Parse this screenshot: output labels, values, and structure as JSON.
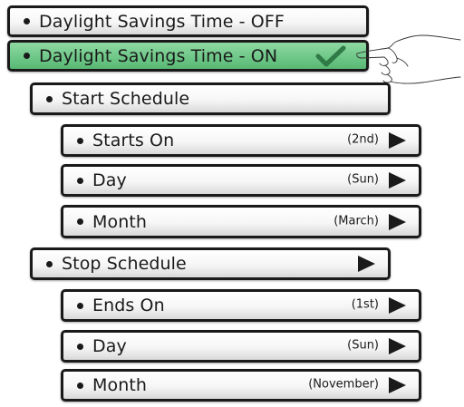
{
  "menu": {
    "dst_off": {
      "label": "Daylight Savings Time - OFF"
    },
    "dst_on": {
      "label": "Daylight Savings Time - ON",
      "selected": true,
      "icon": "checkmark-icon"
    },
    "start_schedule": {
      "label": "Start Schedule",
      "items": [
        {
          "label": "Starts On",
          "value": "(2nd)"
        },
        {
          "label": "Day",
          "value": "(Sun)"
        },
        {
          "label": "Month",
          "value": "(March)"
        }
      ]
    },
    "stop_schedule": {
      "label": "Stop Schedule",
      "items": [
        {
          "label": "Ends On",
          "value": "(1st)"
        },
        {
          "label": "Day",
          "value": "(Sun)"
        },
        {
          "label": "Month",
          "value": "(November)"
        }
      ]
    }
  },
  "icons": {
    "arrow": "play-arrow-icon",
    "pointer": "pointing-hand-icon"
  },
  "colors": {
    "selected_background": "#6cc686",
    "checkmark": "#2f7a47",
    "border": "#1a1a1a"
  }
}
